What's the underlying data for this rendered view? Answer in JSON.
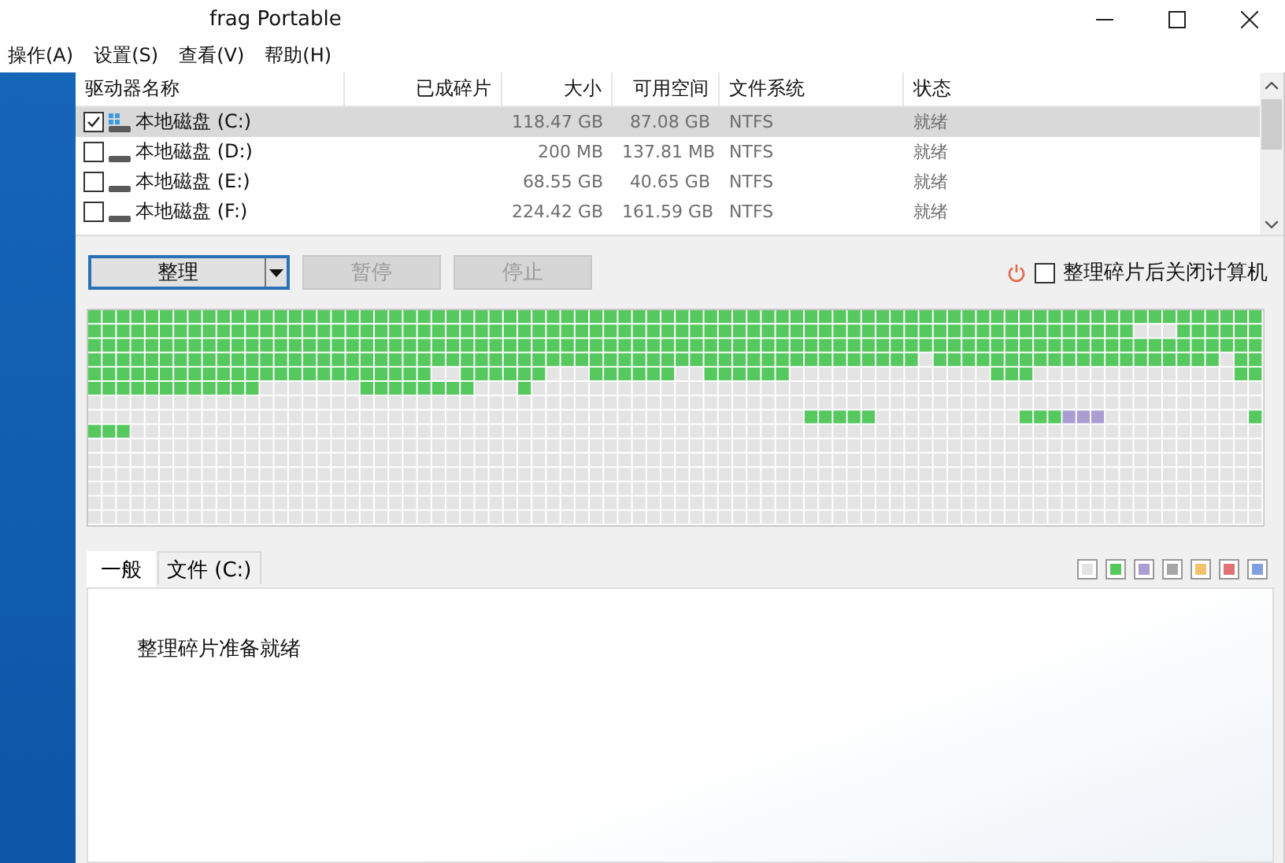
{
  "window": {
    "title": "frag Portable"
  },
  "menu": [
    "操作(A)",
    "设置(S)",
    "查看(V)",
    "帮助(H)"
  ],
  "drives": {
    "columns": [
      "驱动器名称",
      "已成碎片",
      "大小",
      "可用空间",
      "文件系统",
      "状态"
    ],
    "rows": [
      {
        "name": "本地磁盘 (C:)",
        "checked": true,
        "selected": true,
        "system": true,
        "size": "118.47 GB",
        "free": "87.08 GB",
        "fs": "NTFS",
        "status": "就绪"
      },
      {
        "name": "本地磁盘 (D:)",
        "checked": false,
        "selected": false,
        "system": false,
        "size": "200 MB",
        "free": "137.81 MB",
        "fs": "NTFS",
        "status": "就绪"
      },
      {
        "name": "本地磁盘 (E:)",
        "checked": false,
        "selected": false,
        "system": false,
        "size": "68.55 GB",
        "free": "40.65 GB",
        "fs": "NTFS",
        "status": "就绪"
      },
      {
        "name": "本地磁盘 (F:)",
        "checked": false,
        "selected": false,
        "system": false,
        "size": "224.42 GB",
        "free": "161.59 GB",
        "fs": "NTFS",
        "status": "就绪"
      }
    ]
  },
  "actions": [
    {
      "label": "整理",
      "disabled": false,
      "dropdown": true
    },
    {
      "label": "暂停",
      "disabled": true,
      "dropdown": false
    },
    {
      "label": "停止",
      "disabled": true,
      "dropdown": false
    }
  ],
  "shutdown_option": {
    "label": "整理碎片后关闭计算机",
    "checked": false
  },
  "tabs": [
    {
      "label": "一般",
      "selected": true
    },
    {
      "label": "文件 (C:)",
      "selected": false
    }
  ],
  "legend": [
    {
      "color": "#e4e4e4"
    },
    {
      "color": "#55c85e"
    },
    {
      "color": "#a99dd2"
    },
    {
      "color": "#a6a6a6"
    },
    {
      "color": "#f2c26e"
    },
    {
      "color": "#e07272"
    },
    {
      "color": "#7f9fe0"
    }
  ],
  "status_message": "整理碎片准备就绪"
}
